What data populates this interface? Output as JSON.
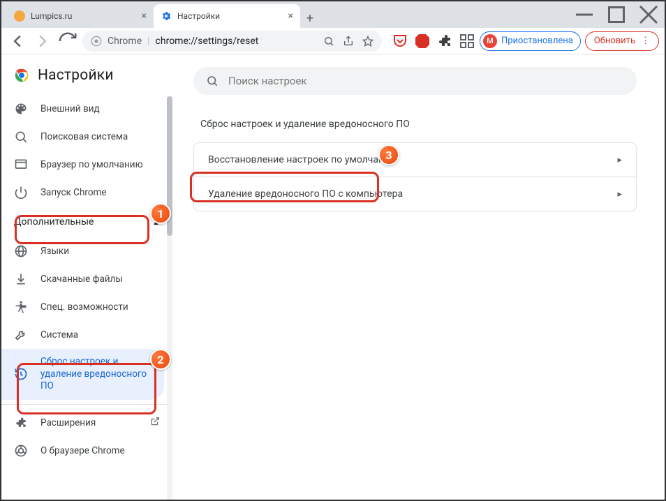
{
  "tabs": [
    {
      "title": "Lumpics.ru",
      "favicon_color": "#f4a73e"
    },
    {
      "title": "Настройки",
      "favicon_color": "#1a73e8"
    }
  ],
  "addressbar": {
    "scheme_label": "Chrome",
    "url": "chrome://settings/reset"
  },
  "profile": {
    "initial": "М",
    "status": "Приостановлена"
  },
  "update_button": "Обновить",
  "sidebar": {
    "title": "Настройки",
    "items_top": [
      {
        "label": "Внешний вид",
        "icon": "palette"
      },
      {
        "label": "Поисковая система",
        "icon": "search"
      },
      {
        "label": "Браузер по умолчанию",
        "icon": "browser"
      },
      {
        "label": "Запуск Chrome",
        "icon": "power"
      }
    ],
    "advanced_label": "Дополнительные",
    "items_adv": [
      {
        "label": "Языки",
        "icon": "globe"
      },
      {
        "label": "Скачанные файлы",
        "icon": "download"
      },
      {
        "label": "Спец. возможности",
        "icon": "accessibility"
      },
      {
        "label": "Система",
        "icon": "wrench"
      },
      {
        "label": "Сброс настроек и удаление вредоносного ПО",
        "icon": "restore",
        "selected": true
      }
    ],
    "items_bottom": [
      {
        "label": "Расширения",
        "icon": "extension",
        "external": true
      },
      {
        "label": "О браузере Chrome",
        "icon": "chrome"
      }
    ]
  },
  "main": {
    "search_placeholder": "Поиск настроек",
    "section_title": "Сброс настроек и удаление вредоносного ПО",
    "rows": [
      "Восстановление настроек по умолчанию",
      "Удаление вредоносного ПО с компьютера"
    ]
  },
  "annotations": [
    "1",
    "2",
    "3"
  ]
}
